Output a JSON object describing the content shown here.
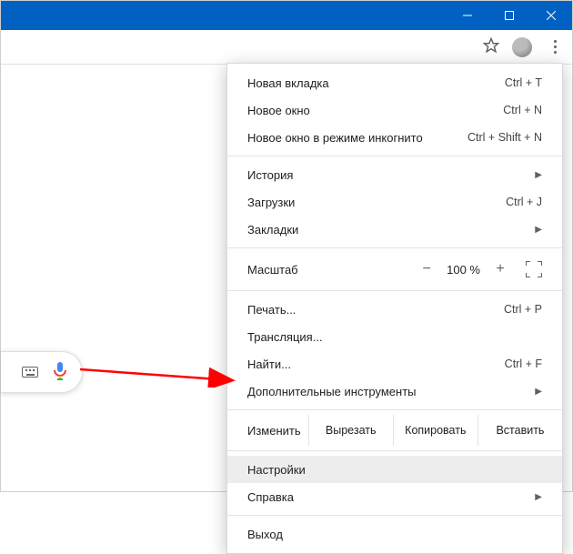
{
  "menu": {
    "new_tab": {
      "label": "Новая вкладка",
      "shortcut": "Ctrl + T"
    },
    "new_window": {
      "label": "Новое окно",
      "shortcut": "Ctrl + N"
    },
    "incognito": {
      "label": "Новое окно в режиме инкогнито",
      "shortcut": "Ctrl + Shift + N"
    },
    "history": {
      "label": "История"
    },
    "downloads": {
      "label": "Загрузки",
      "shortcut": "Ctrl + J"
    },
    "bookmarks": {
      "label": "Закладки"
    },
    "zoom": {
      "label": "Масштаб",
      "value": "100 %"
    },
    "print": {
      "label": "Печать...",
      "shortcut": "Ctrl + P"
    },
    "cast": {
      "label": "Трансляция..."
    },
    "find": {
      "label": "Найти...",
      "shortcut": "Ctrl + F"
    },
    "more_tools": {
      "label": "Дополнительные инструменты"
    },
    "edit": {
      "label": "Изменить",
      "cut": "Вырезать",
      "copy": "Копировать",
      "paste": "Вставить"
    },
    "settings": {
      "label": "Настройки"
    },
    "help": {
      "label": "Справка"
    },
    "exit": {
      "label": "Выход"
    }
  }
}
